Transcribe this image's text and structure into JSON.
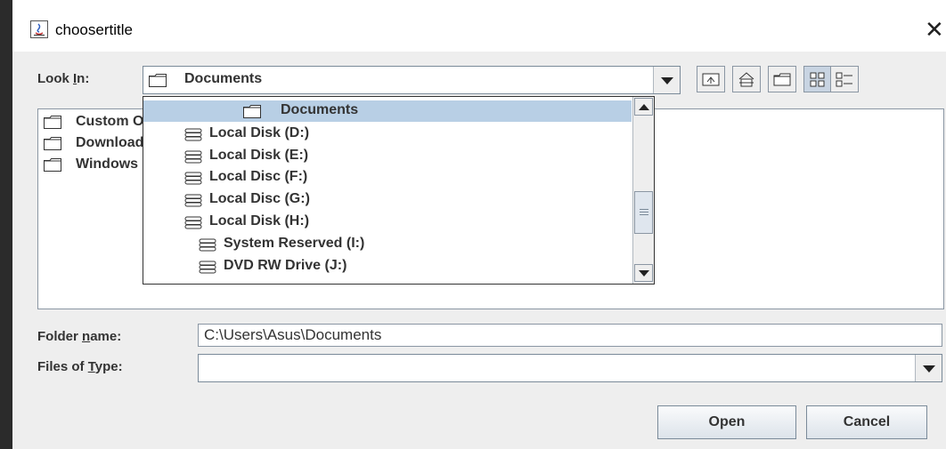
{
  "window": {
    "title": "choosertitle"
  },
  "look_in": {
    "label_pre": "Look ",
    "label_mnemonic": "I",
    "label_post": "n:",
    "selected": "Documents"
  },
  "toolbar": {
    "buttons": [
      "up-one-level-icon",
      "home-icon",
      "new-folder-icon",
      "list-view-icon",
      "details-view-icon"
    ]
  },
  "dropdown": {
    "items": [
      {
        "label": "Documents",
        "icon": "folder-icon",
        "selected": true
      },
      {
        "label": "Local Disk (D:)",
        "icon": "drive-icon"
      },
      {
        "label": "Local Disk (E:)",
        "icon": "drive-icon"
      },
      {
        "label": "Local Disc (F:)",
        "icon": "drive-icon"
      },
      {
        "label": "Local Disc (G:)",
        "icon": "drive-icon"
      },
      {
        "label": "Local Disk (H:)",
        "icon": "drive-icon"
      },
      {
        "label": "System Reserved (I:)",
        "icon": "drive-icon"
      },
      {
        "label": "DVD RW Drive (J:)",
        "icon": "drive-icon"
      }
    ]
  },
  "files": {
    "items": [
      {
        "label": "Custom Office Templates"
      },
      {
        "label": "Downloads"
      },
      {
        "label": "Windows"
      }
    ]
  },
  "folder_name": {
    "label_pre": "Folder ",
    "label_mnemonic": "n",
    "label_post": "ame:",
    "value": "C:\\Users\\Asus\\Documents"
  },
  "files_of_type": {
    "label_pre": "Files of ",
    "label_mnemonic": "T",
    "label_post": "ype:",
    "value": ""
  },
  "buttons": {
    "open": "Open",
    "cancel": "Cancel"
  },
  "colors": {
    "selection": "#b8cfe5",
    "border": "#8a96a3",
    "background": "#eeeeee"
  }
}
